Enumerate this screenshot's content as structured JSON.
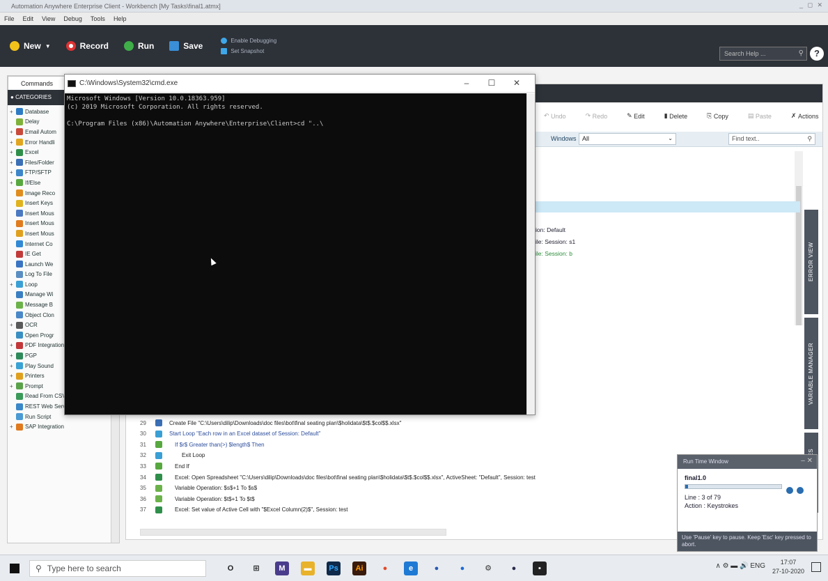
{
  "window": {
    "title": "Automation Anywhere Enterprise Client - Workbench [My Tasks\\final1.atmx]",
    "controls": "_ ◻ ✕"
  },
  "menu": [
    "File",
    "Edit",
    "View",
    "Debug",
    "Tools",
    "Help"
  ],
  "toolbar": {
    "new": "New",
    "record": "Record",
    "run": "Run",
    "save": "Save",
    "enable_debugging": "Enable Debugging",
    "set_snapshot": "Set Snapshot",
    "search_help_placeholder": "Search Help ...",
    "help": "?"
  },
  "sidebar": {
    "tab": "Commands",
    "header": "CATEGORIES",
    "items": [
      {
        "label": "Database",
        "color": "#2e7bc4",
        "exp": "+"
      },
      {
        "label": "Delay",
        "color": "#7fb23a",
        "exp": ""
      },
      {
        "label": "Email Autom",
        "color": "#c94a3a",
        "exp": "+"
      },
      {
        "label": "Error Handli",
        "color": "#e2a51f",
        "exp": "+"
      },
      {
        "label": "Excel",
        "color": "#2f8f4a",
        "exp": "+"
      },
      {
        "label": "Files/Folder",
        "color": "#3a6fb5",
        "exp": "+"
      },
      {
        "label": "FTP/SFTP",
        "color": "#3c86c9",
        "exp": "+"
      },
      {
        "label": "If/Else",
        "color": "#58a840",
        "exp": "+"
      },
      {
        "label": "Image Reco",
        "color": "#e08d1f",
        "exp": ""
      },
      {
        "label": "Insert Keys",
        "color": "#e0b21f",
        "exp": ""
      },
      {
        "label": "Insert Mous",
        "color": "#4b79c2",
        "exp": ""
      },
      {
        "label": "Insert Mous",
        "color": "#e07c1f",
        "exp": ""
      },
      {
        "label": "Insert Mous",
        "color": "#e0a01f",
        "exp": ""
      },
      {
        "label": "Internet Co",
        "color": "#3289d4",
        "exp": ""
      },
      {
        "label": "IE Get",
        "color": "#c23a3a",
        "exp": ""
      },
      {
        "label": "Launch We",
        "color": "#3a74c2",
        "exp": ""
      },
      {
        "label": "Log To File",
        "color": "#5a8ec2",
        "exp": ""
      },
      {
        "label": "Loop",
        "color": "#3a9fd4",
        "exp": "+"
      },
      {
        "label": "Manage Wi",
        "color": "#3a7fc2",
        "exp": ""
      },
      {
        "label": "Message B",
        "color": "#6cb24a",
        "exp": ""
      },
      {
        "label": "Object Clon",
        "color": "#4a88c8",
        "exp": ""
      },
      {
        "label": "OCR",
        "color": "#5a5a5a",
        "exp": "+"
      },
      {
        "label": "Open Progr",
        "color": "#3a8fc2",
        "exp": ""
      },
      {
        "label": "PDF Integration",
        "color": "#c2383a",
        "exp": "+"
      },
      {
        "label": "PGP",
        "color": "#2e8a5a",
        "exp": "+"
      },
      {
        "label": "Play Sound",
        "color": "#3aa2d4",
        "exp": "+"
      },
      {
        "label": "Printers",
        "color": "#e0a01f",
        "exp": "+"
      },
      {
        "label": "Prompt",
        "color": "#5aa24a",
        "exp": "+"
      },
      {
        "label": "Read From CSV/Text",
        "color": "#3a9a5a",
        "exp": ""
      },
      {
        "label": "REST Web Service",
        "color": "#3a88c8",
        "exp": ""
      },
      {
        "label": "Run Script",
        "color": "#4a9ad4",
        "exp": ""
      },
      {
        "label": "SAP Integration",
        "color": "#e07a1f",
        "exp": "+"
      }
    ]
  },
  "main": {
    "actions": {
      "undo": "Undo",
      "redo": "Redo",
      "edit": "Edit",
      "delete": "Delete",
      "copy": "Copy",
      "paste": "Paste",
      "actions": "Actions"
    },
    "windows_label": "Windows",
    "windows_value": "All",
    "find_placeholder": "Find text..",
    "side_tabs": [
      "ERROR VIEW",
      "VARIABLE MANAGER",
      "DEPENDENCIES"
    ],
    "partial_lines": [
      {
        "text": "ion: Default",
        "green": false
      },
      {
        "text": "ile: Session: s1",
        "green": false
      },
      {
        "text": "ile: Session: b",
        "green": true
      }
    ],
    "lines": [
      {
        "num": "29",
        "text": "Create File \"C:\\Users\\dilip\\Downloads\\doc files\\bot\\final seating plan\\$holidata\\$t$.$col$$.xlsx\"",
        "color": "#3a6fb5",
        "indent": 0,
        "textcolor": "#222"
      },
      {
        "num": "30",
        "text": "Start Loop \"Each row in an Excel dataset of Session: Default\"",
        "color": "#3a9fd4",
        "indent": 0,
        "textcolor": "#2b4c9a"
      },
      {
        "num": "31",
        "text": "If $r$ Greater than(>) $length$ Then",
        "color": "#58a840",
        "indent": 8,
        "textcolor": "#2b4c9a"
      },
      {
        "num": "32",
        "text": "Exit Loop",
        "color": "#3a9fd4",
        "indent": 18,
        "textcolor": "#222"
      },
      {
        "num": "33",
        "text": "End If",
        "color": "#58a840",
        "indent": 8,
        "textcolor": "#222"
      },
      {
        "num": "34",
        "text": "Excel: Open Spreadsheet \"C:\\Users\\dilip\\Downloads\\doc files\\bot\\final seating plan\\$holidata\\$t$.$col$$.xlsx\", ActiveSheet: \"Default\", Session: test",
        "color": "#2f8f4a",
        "indent": 8,
        "textcolor": "#222"
      },
      {
        "num": "35",
        "text": "Variable Operation: $s$+1 To $s$",
        "color": "#6cb24a",
        "indent": 8,
        "textcolor": "#222"
      },
      {
        "num": "36",
        "text": "Variable Operation: $t$+1 To $t$",
        "color": "#6cb24a",
        "indent": 8,
        "textcolor": "#222"
      },
      {
        "num": "37",
        "text": "Excel: Set value of Active Cell with \"$Excel Column(2)$\", Session: test",
        "color": "#2f8f4a",
        "indent": 8,
        "textcolor": "#222"
      }
    ]
  },
  "cmd": {
    "title": "C:\\Windows\\System32\\cmd.exe",
    "controls": [
      "–",
      "☐",
      "✕"
    ],
    "lines": [
      "Microsoft Windows [Version 10.0.18363.959]",
      "(c) 2019 Microsoft Corporation. All rights reserved.",
      "",
      "C:\\Program Files (x86)\\Automation Anywhere\\Enterprise\\Client>cd \"..\\"
    ]
  },
  "runtime": {
    "title": "Run Time Window",
    "task": "final1.0",
    "progress": 0.03,
    "line": "Line : 3 of 79",
    "action": "Action : Keystrokes",
    "footer": "Use 'Pause' key to pause. Keep 'Esc' key pressed to abort."
  },
  "taskbar": {
    "search_placeholder": "Type here to search",
    "apps": [
      {
        "name": "cortana-icon",
        "glyph": "O",
        "color": "#e8ecf0",
        "fg": "#222"
      },
      {
        "name": "task-view-icon",
        "glyph": "⊞",
        "color": "#e8ecf0",
        "fg": "#222"
      },
      {
        "name": "vs-icon",
        "glyph": "M",
        "color": "#4a3c8c",
        "fg": "#fff"
      },
      {
        "name": "file-explorer-icon",
        "glyph": "▬",
        "color": "#e8b22a",
        "fg": "#fff"
      },
      {
        "name": "photoshop-icon",
        "glyph": "Ps",
        "color": "#0f2a4a",
        "fg": "#31a8ff"
      },
      {
        "name": "illustrator-icon",
        "glyph": "Ai",
        "color": "#3a1a0a",
        "fg": "#ff9a00"
      },
      {
        "name": "chrome-icon",
        "glyph": "●",
        "color": "#e8ecf0",
        "fg": "#e04a2a"
      },
      {
        "name": "edge-icon",
        "glyph": "e",
        "color": "#1f7ad4",
        "fg": "#fff"
      },
      {
        "name": "app-icon",
        "glyph": "●",
        "color": "#e8ecf0",
        "fg": "#2a5ab4"
      },
      {
        "name": "aa-icon",
        "glyph": "●",
        "color": "#e8ecf0",
        "fg": "#1f6ad4"
      },
      {
        "name": "settings-icon",
        "glyph": "⚙",
        "color": "#e8ecf0",
        "fg": "#333"
      },
      {
        "name": "firefox-icon",
        "glyph": "●",
        "color": "#e8ecf0",
        "fg": "#2a2a4a"
      },
      {
        "name": "cmd-icon",
        "glyph": "▪",
        "color": "#222",
        "fg": "#fff"
      }
    ],
    "tray": "∧ ⚙ ▬ 🔊 ENG",
    "time": "17:07",
    "date": "27-10-2020"
  }
}
